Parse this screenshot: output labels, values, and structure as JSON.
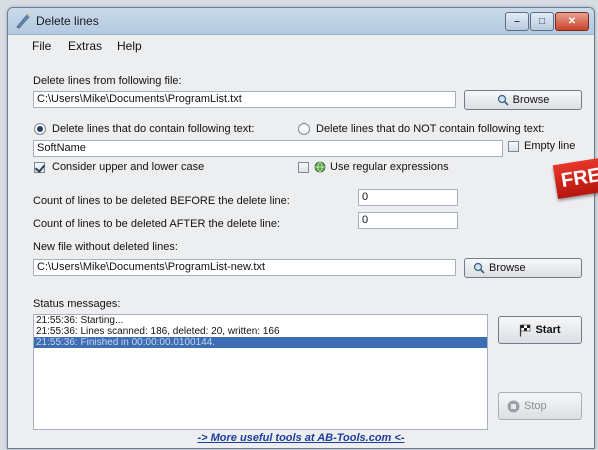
{
  "window": {
    "title": "Delete lines",
    "controls": {
      "minimize": "–",
      "maximize": "□",
      "close": "✕"
    }
  },
  "menu": {
    "file": "File",
    "extras": "Extras",
    "help": "Help"
  },
  "source": {
    "label": "Delete lines from following file:",
    "value": "C:\\Users\\Mike\\Documents\\ProgramList.txt",
    "browse_label": "Browse"
  },
  "mode": {
    "contain_label": "Delete lines that do contain following text:",
    "not_contain_label": "Delete lines that do NOT contain following text:",
    "selected": "contain"
  },
  "search": {
    "value": "SoftName"
  },
  "options": {
    "empty_line_label": "Empty line",
    "empty_line_checked": false,
    "case_label": "Consider upper and lower case",
    "case_checked": true,
    "regex_label": "Use regular expressions",
    "regex_checked": false
  },
  "counts": {
    "before_label": "Count of lines to be deleted BEFORE the delete line:",
    "before_value": "0",
    "after_label": "Count of lines to be deleted AFTER the delete line:",
    "after_value": "0"
  },
  "output": {
    "label": "New file without deleted lines:",
    "value": "C:\\Users\\Mike\\Documents\\ProgramList-new.txt",
    "browse_label": "Browse"
  },
  "status": {
    "label": "Status messages:",
    "lines": [
      "21:55:36: Starting...",
      "21:55:36: Lines scanned: 186, deleted: 20, written: 166",
      "21:55:36: Finished in 00:00:00.0100144."
    ]
  },
  "actions": {
    "start_label": "Start",
    "stop_label": "Stop"
  },
  "footer": {
    "link_text": "-> More useful tools at AB-Tools.com <-"
  },
  "badge": {
    "text": "FREE"
  },
  "colors": {
    "selection": "#3d6eb5",
    "link": "#1c3d9a",
    "badge": "#d42a1f"
  }
}
